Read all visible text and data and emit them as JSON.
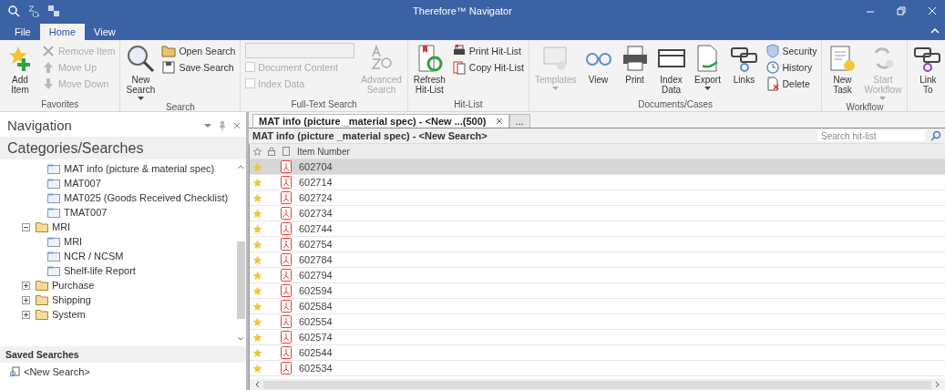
{
  "window": {
    "title": "Therefore™ Navigator"
  },
  "ribbon_tabs": [
    {
      "label": "File",
      "selected": false
    },
    {
      "label": "Home",
      "selected": true
    },
    {
      "label": "View",
      "selected": false
    }
  ],
  "ribbon_groups": [
    {
      "label": "Favorites",
      "items": [
        {
          "kind": "large",
          "label": "Add\nItem",
          "disabled": false,
          "dropdown": false
        },
        {
          "kind": "stack",
          "items": [
            {
              "kind": "small",
              "label": "Remove Item",
              "disabled": true
            },
            {
              "kind": "small",
              "label": "Move Up",
              "disabled": true
            },
            {
              "kind": "small",
              "label": "Move Down",
              "disabled": true
            }
          ]
        }
      ]
    },
    {
      "label": "Search",
      "items": [
        {
          "kind": "large",
          "label": "New\nSearch",
          "disabled": false,
          "dropdown": true
        },
        {
          "kind": "stack",
          "items": [
            {
              "kind": "small",
              "label": "Open Search",
              "disabled": false
            },
            {
              "kind": "small",
              "label": "Save Search",
              "disabled": false
            }
          ]
        }
      ]
    },
    {
      "label": "Full-Text Search",
      "items": [
        {
          "kind": "stack",
          "items": [
            {
              "kind": "field"
            },
            {
              "kind": "check",
              "label": "Document Content",
              "disabled": true,
              "checked": false
            },
            {
              "kind": "check",
              "label": "Index Data",
              "disabled": true,
              "checked": false
            }
          ]
        },
        {
          "kind": "large",
          "label": "Advanced\nSearch",
          "disabled": true,
          "dropdown": false
        }
      ]
    },
    {
      "label": "Hit-List",
      "items": [
        {
          "kind": "large",
          "label": "Refresh\nHit-List",
          "disabled": false,
          "dropdown": false
        },
        {
          "kind": "stack",
          "items": [
            {
              "kind": "small",
              "label": "Print Hit-List",
              "disabled": false
            },
            {
              "kind": "small",
              "label": "Copy Hit-List",
              "disabled": false
            }
          ]
        }
      ]
    },
    {
      "label": "Documents/Cases",
      "items": [
        {
          "kind": "large",
          "label": "Templates",
          "disabled": true,
          "dropdown": true
        },
        {
          "kind": "large",
          "label": "View",
          "disabled": false,
          "dropdown": false
        },
        {
          "kind": "large",
          "label": "Print",
          "disabled": false,
          "dropdown": false
        },
        {
          "kind": "large",
          "label": "Index\nData",
          "disabled": false,
          "dropdown": false
        },
        {
          "kind": "large",
          "label": "Export",
          "disabled": false,
          "dropdown": true
        },
        {
          "kind": "large",
          "label": "Links",
          "disabled": false,
          "dropdown": false
        },
        {
          "kind": "stack",
          "items": [
            {
              "kind": "small",
              "label": "Security",
              "disabled": false
            },
            {
              "kind": "small",
              "label": "History",
              "disabled": false
            },
            {
              "kind": "small",
              "label": "Delete",
              "disabled": false
            }
          ]
        }
      ]
    },
    {
      "label": "Workflow",
      "items": [
        {
          "kind": "large",
          "label": "New\nTask",
          "disabled": false,
          "dropdown": false
        },
        {
          "kind": "large",
          "label": "Start\nWorkflow",
          "disabled": true,
          "dropdown": true
        }
      ]
    },
    {
      "items": [
        {
          "kind": "large",
          "label": "Link\nTo",
          "disabled": false,
          "dropdown": false
        }
      ]
    }
  ],
  "navigation": {
    "title": "Navigation",
    "section": "Categories/Searches",
    "tree": [
      {
        "kind": "search",
        "label": "MAT info (picture & material spec)"
      },
      {
        "kind": "search",
        "label": "MAT007"
      },
      {
        "kind": "search",
        "label": "MAT025 (Goods Received Checklist)"
      },
      {
        "kind": "search",
        "label": "TMAT007"
      },
      {
        "kind": "folder",
        "label": "MRI",
        "expanded": true,
        "children": [
          {
            "kind": "search",
            "label": "MRI"
          },
          {
            "kind": "search",
            "label": "NCR / NCSM"
          },
          {
            "kind": "search",
            "label": "Shelf-life Report"
          }
        ]
      },
      {
        "kind": "folder",
        "label": "Purchase",
        "expanded": false
      },
      {
        "kind": "folder",
        "label": "Shipping",
        "expanded": false
      },
      {
        "kind": "folder",
        "label": "System",
        "expanded": false
      }
    ],
    "saved_title": "Saved Searches",
    "saved": [
      "<New Search>"
    ]
  },
  "doc_tabs": [
    {
      "label": "MAT info (picture _material spec) - <New ...(500)",
      "selected": true,
      "closable": true
    },
    {
      "label": "...",
      "selected": false,
      "closable": false
    }
  ],
  "hit_list": {
    "title": "MAT info (picture _material spec) - <New Search>",
    "search": {
      "placeholder": "Search hit-list"
    },
    "columns": [
      "Item Number"
    ],
    "rows": [
      {
        "item_number": "602704",
        "selected": true
      },
      {
        "item_number": "602714",
        "selected": false
      },
      {
        "item_number": "602724",
        "selected": false
      },
      {
        "item_number": "602734",
        "selected": false
      },
      {
        "item_number": "602744",
        "selected": false
      },
      {
        "item_number": "602754",
        "selected": false
      },
      {
        "item_number": "602784",
        "selected": false
      },
      {
        "item_number": "602794",
        "selected": false
      },
      {
        "item_number": "602594",
        "selected": false
      },
      {
        "item_number": "602584",
        "selected": false
      },
      {
        "item_number": "602554",
        "selected": false
      },
      {
        "item_number": "602574",
        "selected": false
      },
      {
        "item_number": "602544",
        "selected": false
      },
      {
        "item_number": "602534",
        "selected": false
      }
    ]
  }
}
